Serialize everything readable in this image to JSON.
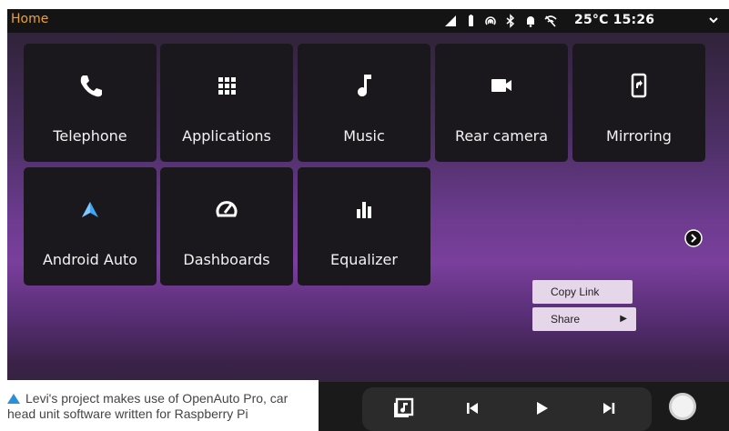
{
  "topbar": {
    "title": "Home",
    "temperature": "25°C",
    "time": "15:26",
    "icons": [
      "signal-icon",
      "battery-icon",
      "hotspot-icon",
      "bluetooth-icon",
      "notification-bell-icon",
      "wifi-off-icon",
      "chevron-down-icon"
    ]
  },
  "tiles": [
    {
      "label": "Telephone",
      "icon": "phone-icon"
    },
    {
      "label": "Applications",
      "icon": "grid-icon"
    },
    {
      "label": "Music",
      "icon": "music-note-icon"
    },
    {
      "label": "Rear camera",
      "icon": "video-camera-icon"
    },
    {
      "label": "Mirroring",
      "icon": "phone-mirroring-icon"
    },
    {
      "label": "Android Auto",
      "icon": "android-auto-icon"
    },
    {
      "label": "Dashboards",
      "icon": "gauge-icon"
    },
    {
      "label": "Equalizer",
      "icon": "equalizer-icon"
    }
  ],
  "context_menu": {
    "copy_link": "Copy Link",
    "share": "Share"
  },
  "bottombar": {
    "media": [
      "music-app-icon",
      "previous-track-icon",
      "play-icon",
      "next-track-icon"
    ],
    "home": "home-button-icon"
  },
  "caption": {
    "text": "Levi's project makes use of OpenAuto Pro, car head unit software written for Raspberry Pi"
  },
  "colors": {
    "accent": "#e8a23c",
    "tile_bg": "#1b181d",
    "android_auto_blue": "#3ea6f2",
    "caption_triangle": "#2b8fd8"
  }
}
